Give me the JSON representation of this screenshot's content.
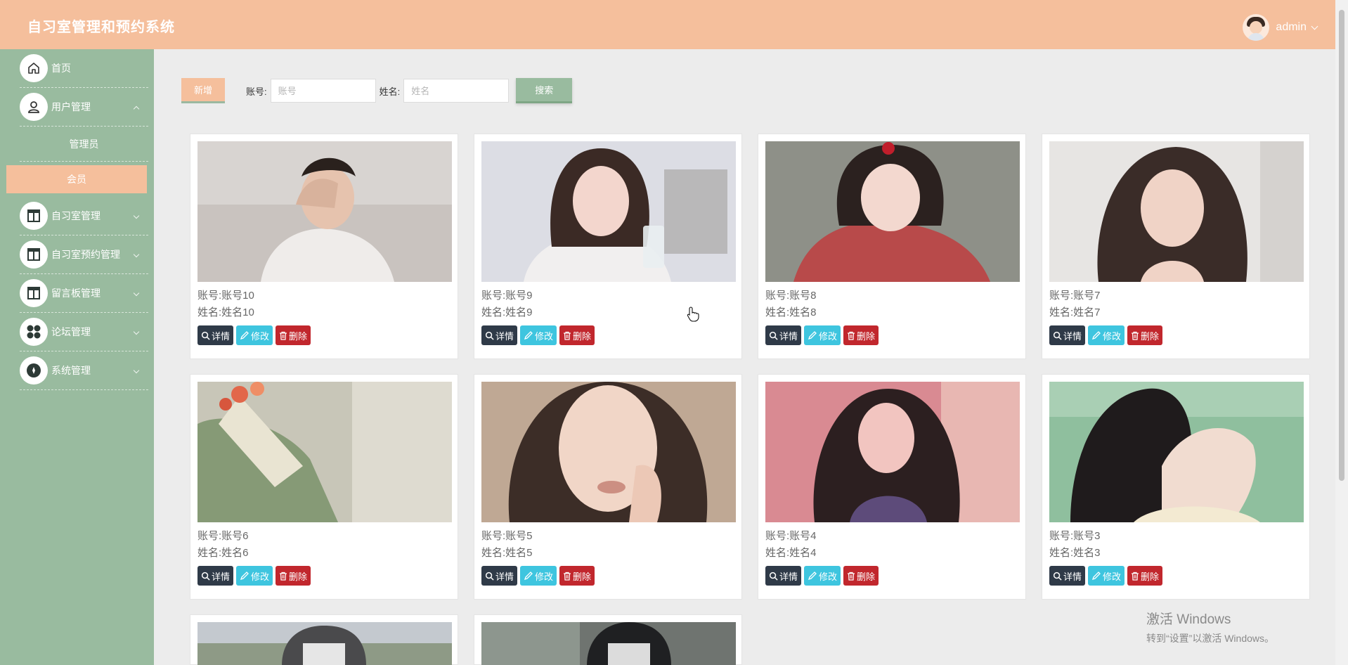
{
  "header": {
    "title": "自习室管理和预约系统",
    "username": "admin"
  },
  "sidebar": {
    "items": [
      {
        "label": "首页",
        "icon": "home-icon",
        "expanded": null
      },
      {
        "label": "用户管理",
        "icon": "user-icon",
        "expanded": true,
        "children": [
          {
            "label": "管理员",
            "active": false
          },
          {
            "label": "会员",
            "active": true
          }
        ]
      },
      {
        "label": "自习室管理",
        "icon": "layout-icon",
        "expanded": false
      },
      {
        "label": "自习室预约管理",
        "icon": "layout-icon",
        "expanded": false
      },
      {
        "label": "留言板管理",
        "icon": "layout-icon",
        "expanded": false
      },
      {
        "label": "论坛管理",
        "icon": "grid-icon",
        "expanded": false
      },
      {
        "label": "系统管理",
        "icon": "compass-icon",
        "expanded": false
      }
    ]
  },
  "toolbar": {
    "add_label": "新增",
    "account_label": "账号:",
    "account_placeholder": "账号",
    "account_value": "",
    "name_label": "姓名:",
    "name_placeholder": "姓名",
    "name_value": "",
    "search_label": "搜索"
  },
  "card_labels": {
    "account_prefix": "账号:",
    "name_prefix": "姓名:",
    "detail": "详情",
    "edit": "修改",
    "delete": "删除"
  },
  "cards": [
    {
      "account": "账号10",
      "name": "姓名10"
    },
    {
      "account": "账号9",
      "name": "姓名9"
    },
    {
      "account": "账号8",
      "name": "姓名8"
    },
    {
      "account": "账号7",
      "name": "姓名7"
    },
    {
      "account": "账号6",
      "name": "姓名6"
    },
    {
      "account": "账号5",
      "name": "姓名5"
    },
    {
      "account": "账号4",
      "name": "姓名4"
    },
    {
      "account": "账号3",
      "name": "姓名3"
    },
    {
      "account": "",
      "name": ""
    },
    {
      "account": "",
      "name": ""
    }
  ],
  "watermark": {
    "line1": "激活 Windows",
    "line2": "转到“设置”以激活 Windows。"
  },
  "colors": {
    "header": "#f5bf9c",
    "sidebar": "#99bb9f",
    "detail": "#2f3a48",
    "edit": "#3ec5df",
    "delete": "#c1272d"
  }
}
